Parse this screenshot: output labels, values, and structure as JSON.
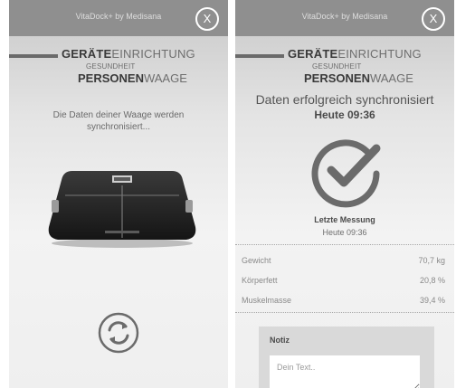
{
  "app_title": "VitaDock+ by Medisana",
  "close_label": "X",
  "header": {
    "bold1": "GERÄTE",
    "rest1": "EINRICHTUNG",
    "line2": "GESUNDHEIT",
    "bold3": "PERSONEN",
    "rest3": "WAAGE"
  },
  "screen_left": {
    "sync_message": "Die Daten deiner Waage werden synchronisiert..."
  },
  "screen_right": {
    "success_title": "Daten erfolgreich synchronisiert",
    "success_time": "Heute 09:36",
    "last_label": "Letzte Messung",
    "last_time": "Heute 09:36",
    "metrics": [
      {
        "name": "Gewicht",
        "value": "70,7 kg"
      },
      {
        "name": "Körperfett",
        "value": "20,8 %"
      },
      {
        "name": "Muskelmasse",
        "value": "39,4 %"
      }
    ],
    "note": {
      "title": "Notiz",
      "placeholder": "Dein Text.."
    }
  },
  "colors": {
    "topbar": "#8f8f8f",
    "text_dark": "#3a3a3a",
    "text_mid": "#6e6e6e",
    "check_gray": "#6b6b6b"
  },
  "icons": {
    "close": "close-icon",
    "sync": "sync-icon",
    "success": "check-circle-icon",
    "scale": "body-scale-icon"
  }
}
